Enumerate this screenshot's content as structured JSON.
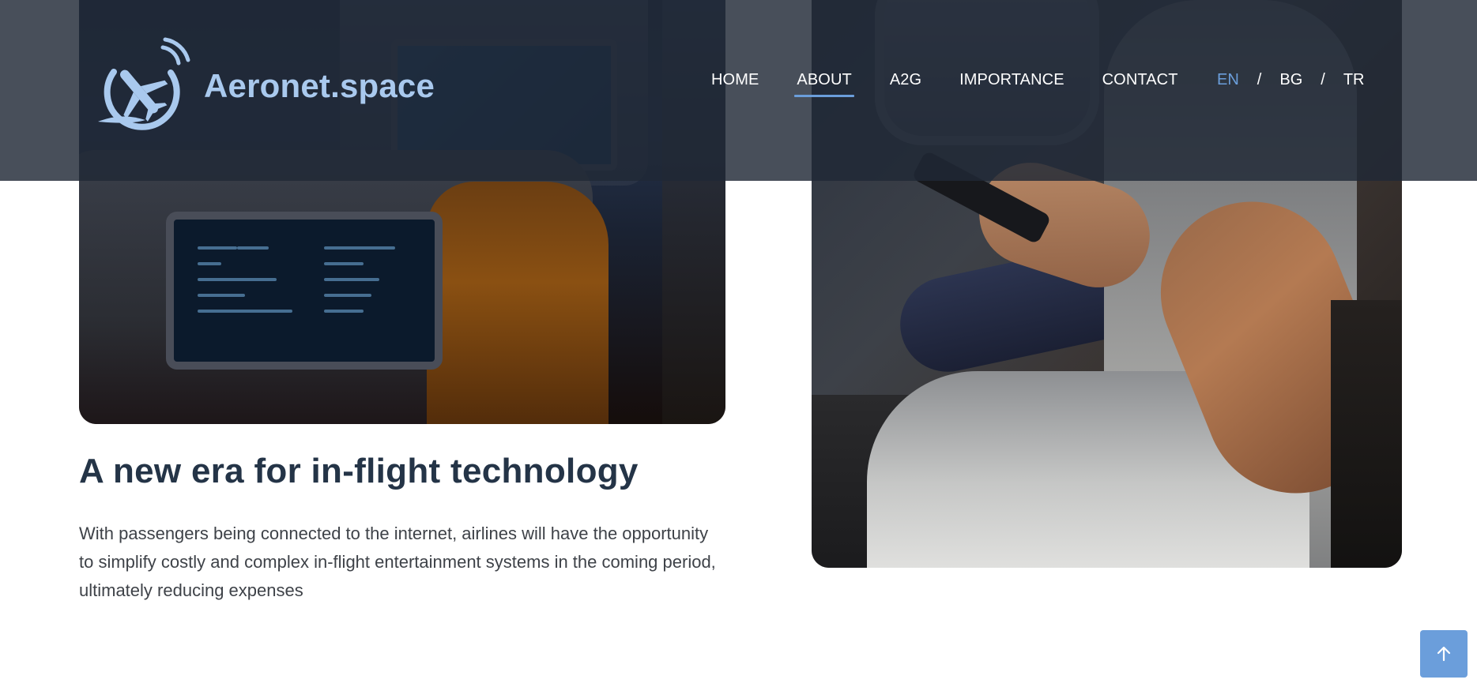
{
  "brand": {
    "name": "Aeronet.space",
    "logo_icon": "plane-signal-icon"
  },
  "nav": {
    "items": [
      {
        "label": "HOME",
        "active": false
      },
      {
        "label": "ABOUT",
        "active": true
      },
      {
        "label": "A2G",
        "active": false
      },
      {
        "label": "IMPORTANCE",
        "active": false
      },
      {
        "label": "CONTACT",
        "active": false
      }
    ]
  },
  "languages": {
    "options": [
      "EN",
      "BG",
      "TR"
    ],
    "current": "EN",
    "separator": "/"
  },
  "content": {
    "heading": "A new era for in-flight technology",
    "paragraph": "With passengers being connected to the internet, airlines will have the opportunity to simplify costly and complex in-flight entertainment systems in the coming period, ultimately reducing expenses"
  },
  "back_to_top": {
    "icon": "arrow-up-icon"
  },
  "colors": {
    "accent": "#6b9edb",
    "header_bg": "#202836",
    "heading": "#243447",
    "body_text": "#3e4248",
    "logo_text": "#a9c9ee"
  }
}
